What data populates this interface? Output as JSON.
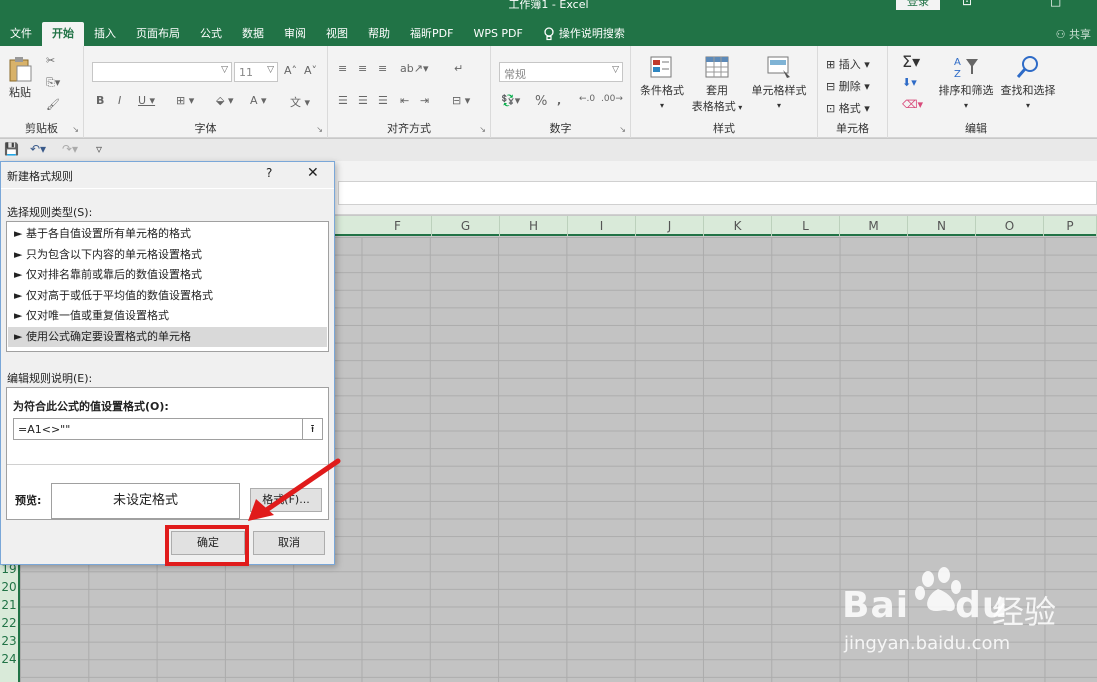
{
  "window": {
    "title": "工作簿1 - Excel",
    "login": "登录"
  },
  "ribbon_tabs": [
    "文件",
    "开始",
    "插入",
    "页面布局",
    "公式",
    "数据",
    "审阅",
    "视图",
    "帮助",
    "福昕PDF",
    "WPS PDF",
    "操作说明搜索"
  ],
  "active_tab": "开始",
  "share": "共享",
  "ribbon": {
    "clipboard": {
      "label": "剪贴板",
      "paste": "粘贴"
    },
    "font": {
      "label": "字体",
      "size": "11"
    },
    "alignment": {
      "label": "对齐方式"
    },
    "number": {
      "label": "数字",
      "format": "常规"
    },
    "styles": {
      "label": "样式",
      "conditional": "条件格式",
      "table1": "套用",
      "table2": "表格格式",
      "cell_styles": "单元格样式"
    },
    "cells": {
      "label": "单元格",
      "insert": "插入",
      "delete": "删除",
      "format": "格式"
    },
    "editing": {
      "label": "编辑",
      "sort_filter": "排序和筛选",
      "find_select": "查找和选择"
    }
  },
  "columns": [
    "F",
    "G",
    "H",
    "I",
    "J",
    "K",
    "L",
    "M",
    "N",
    "O",
    "P"
  ],
  "rows": [
    "19",
    "20",
    "21",
    "22",
    "23",
    "24"
  ],
  "dialog": {
    "title": "新建格式规则",
    "help": "?",
    "close": "✕",
    "rule_type_label": "选择规则类型(S):",
    "rule_types": [
      "► 基于各自值设置所有单元格的格式",
      "► 只为包含以下内容的单元格设置格式",
      "► 仅对排名靠前或靠后的数值设置格式",
      "► 仅对高于或低于平均值的数值设置格式",
      "► 仅对唯一值或重复值设置格式",
      "► 使用公式确定要设置格式的单元格"
    ],
    "selected_index": 5,
    "description_label": "编辑规则说明(E):",
    "formula_heading": "为符合此公式的值设置格式(O):",
    "formula_value": "=A1<>\"\"",
    "preview_label": "预览:",
    "preview_text": "未设定格式",
    "format_button": "格式(F)...",
    "ok_button": "确定",
    "cancel_button": "取消"
  },
  "watermark": {
    "brand": "Bai",
    "brand_du": "du",
    "cn": "经验",
    "url": "jingyan.baidu.com"
  },
  "colors": {
    "excel_green": "#217346",
    "highlight_red": "#e01b1b"
  }
}
